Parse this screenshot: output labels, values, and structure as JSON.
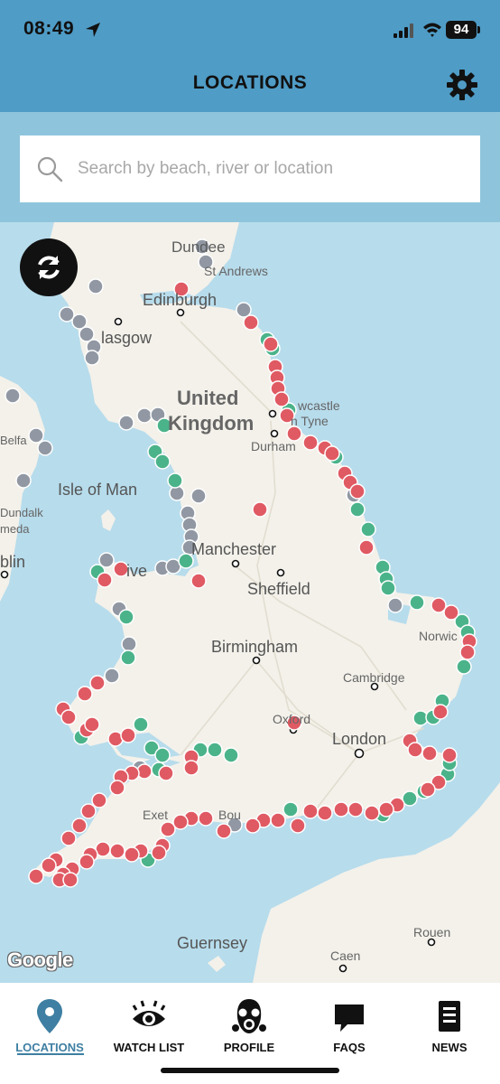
{
  "status_bar": {
    "time": "08:49",
    "battery": "94"
  },
  "header": {
    "title": "LOCATIONS"
  },
  "search": {
    "placeholder": "Search by beach, river or location"
  },
  "map": {
    "labels": {
      "dundee": "Dundee",
      "st_andrews": "St Andrews",
      "edinburgh": "Edinburgh",
      "glasgow": "lasgow",
      "united": "United",
      "kingdom": "Kingdom",
      "newcastle": "wcastle",
      "tyne": "n Tyne",
      "durham": "Durham",
      "belfast": "Belfa",
      "isle_of_man": "Isle of Man",
      "dundalk": "Dundalk",
      "meda": "meda",
      "dublin": "blin",
      "manchester": "Manchester",
      "liverpool": "ive",
      "sheffield": "Sheffield",
      "norwich": "Norwic",
      "birmingham": "Birmingham",
      "cambridge": "Cambridge",
      "oxford": "Oxford",
      "london": "London",
      "exeter": "Exet",
      "bournemouth": "Bou",
      "guernsey": "Guernsey",
      "rouen": "Rouen",
      "caen": "Caen"
    },
    "attribution": "Google",
    "colors": {
      "poor": "#e05a63",
      "good": "#4bb38a",
      "no_data": "#9198a3",
      "sea": "#b7dcec",
      "land": "#f3f1ea"
    }
  },
  "nav": {
    "items": [
      {
        "label": "LOCATIONS",
        "icon": "map-pin-icon",
        "active": true
      },
      {
        "label": "WATCH LIST",
        "icon": "eye-icon",
        "active": false
      },
      {
        "label": "PROFILE",
        "icon": "gas-mask-icon",
        "active": false
      },
      {
        "label": "FAQS",
        "icon": "speech-bubble-icon",
        "active": false
      },
      {
        "label": "NEWS",
        "icon": "document-icon",
        "active": false
      }
    ]
  }
}
